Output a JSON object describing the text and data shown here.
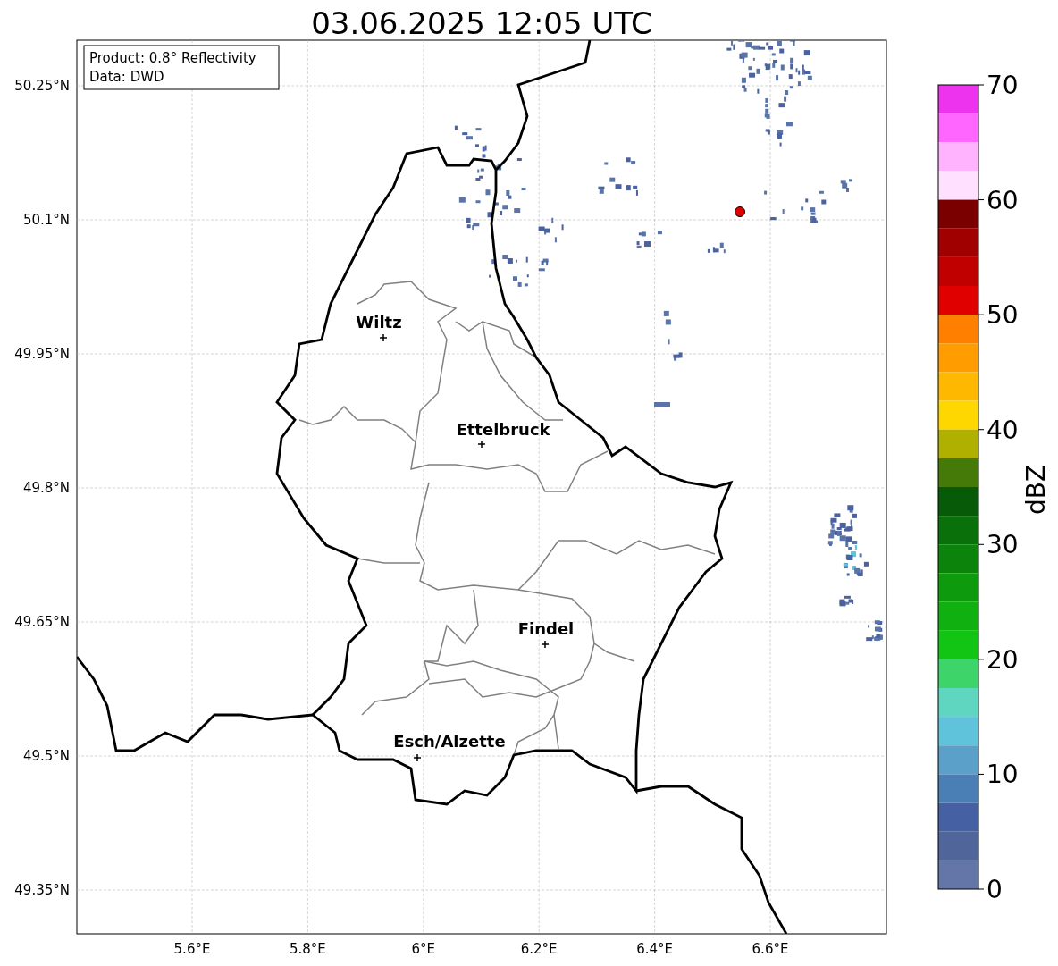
{
  "title": "03.06.2025 12:05 UTC",
  "info_box": {
    "lines": [
      "Product: 0.8° Reflectivity",
      "Data: DWD"
    ]
  },
  "map": {
    "y_ticks": [
      "50.25°N",
      "50.1°N",
      "49.95°N",
      "49.8°N",
      "49.65°N",
      "49.5°N",
      "49.35°N"
    ],
    "x_ticks": [
      "5.6°E",
      "5.8°E",
      "6°E",
      "6.2°E",
      "6.4°E",
      "6.6°E"
    ],
    "places": [
      {
        "name": "Wiltz"
      },
      {
        "name": "Ettelbruck"
      },
      {
        "name": "Findel"
      },
      {
        "name": "Esch/Alzette"
      }
    ]
  },
  "colorbar": {
    "label": "dBZ",
    "ticks": [
      "70",
      "60",
      "50",
      "40",
      "30",
      "20",
      "10",
      "0"
    ],
    "segments": [
      {
        "color": "#ee33ee"
      },
      {
        "color": "#ff66ff"
      },
      {
        "color": "#ffb3ff"
      },
      {
        "color": "#ffe0ff"
      },
      {
        "color": "#7a0000"
      },
      {
        "color": "#a00000"
      },
      {
        "color": "#c00000"
      },
      {
        "color": "#e00000"
      },
      {
        "color": "#ff7f00"
      },
      {
        "color": "#ff9c00"
      },
      {
        "color": "#ffb800"
      },
      {
        "color": "#ffd700"
      },
      {
        "color": "#b0b000"
      },
      {
        "color": "#457a08"
      },
      {
        "color": "#075a07"
      },
      {
        "color": "#0a700a"
      },
      {
        "color": "#0c840c"
      },
      {
        "color": "#0d9a0d"
      },
      {
        "color": "#10b010"
      },
      {
        "color": "#12c414"
      },
      {
        "color": "#3dd46a"
      },
      {
        "color": "#5fd6c0"
      },
      {
        "color": "#5fc3dc"
      },
      {
        "color": "#5aa0c8"
      },
      {
        "color": "#4a7fb5"
      },
      {
        "color": "#4560a3"
      },
      {
        "color": "#50669b"
      },
      {
        "color": "#6476a8"
      }
    ]
  }
}
